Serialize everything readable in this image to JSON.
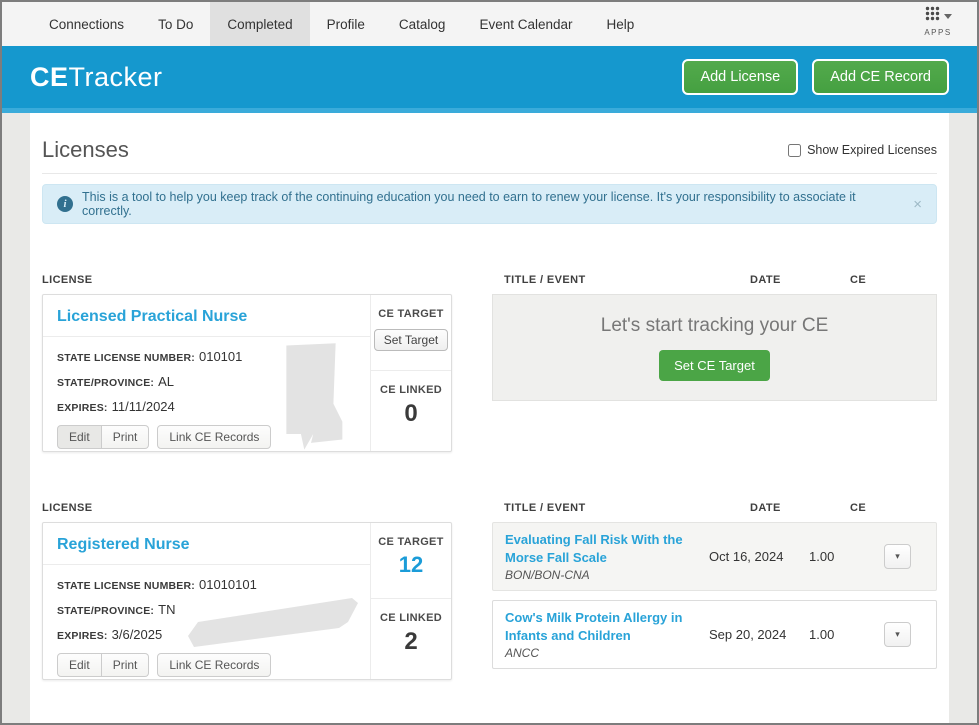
{
  "topnav": {
    "items": [
      {
        "label": "Connections",
        "active": false
      },
      {
        "label": "To Do",
        "active": false
      },
      {
        "label": "Completed",
        "active": true
      },
      {
        "label": "Profile",
        "active": false
      },
      {
        "label": "Catalog",
        "active": false
      },
      {
        "label": "Event Calendar",
        "active": false
      },
      {
        "label": "Help",
        "active": false
      }
    ],
    "apps_label": "APPS"
  },
  "header": {
    "logo_bold": "CE",
    "logo_light": "Tracker",
    "add_license_label": "Add License",
    "add_ce_record_label": "Add CE Record"
  },
  "page": {
    "title": "Licenses",
    "show_expired_label": "Show Expired Licenses",
    "info_message": "This is a tool to help you keep track of the continuing education you need to earn to renew your license. It's your responsibility to associate it correctly."
  },
  "labels": {
    "license_section": "LICENSE",
    "ce_target": "CE TARGET",
    "ce_linked": "CE LINKED",
    "title_event": "TITLE / EVENT",
    "date": "DATE",
    "ce": "CE",
    "state_license_number": "STATE LICENSE NUMBER:",
    "state_province": "STATE/PROVINCE:",
    "expires": "EXPIRES:",
    "edit": "Edit",
    "print": "Print",
    "link_ce_records": "Link CE Records",
    "set_target": "Set Target"
  },
  "licenses": [
    {
      "name": "Licensed Practical Nurse",
      "state_license_number": "010101",
      "state_province": "AL",
      "expires": "11/11/2024",
      "ce_linked": "0",
      "state_icon": "alabama"
    },
    {
      "name": "Registered Nurse",
      "state_license_number": "01010101",
      "state_province": "TN",
      "expires": "3/6/2025",
      "ce_target": "12",
      "ce_linked": "2",
      "state_icon": "tennessee"
    }
  ],
  "empty_state": {
    "message": "Let's start tracking your CE",
    "button_label": "Set CE Target"
  },
  "records": [
    {
      "title": "Evaluating Fall Risk With the Morse Fall Scale",
      "provider": "BON/BON-CNA",
      "date": "Oct 16, 2024",
      "ce": "1.00"
    },
    {
      "title": "Cow's Milk Protein Allergy in Infants and Children",
      "provider": "ANCC",
      "date": "Sep 20, 2024",
      "ce": "1.00"
    }
  ],
  "icons": {
    "info": "i",
    "close": "×",
    "caret_down": "▾"
  },
  "colors": {
    "brand_blue": "#1598ce",
    "brand_blue_light": "#3aabda",
    "button_green": "#4ba546",
    "link_blue": "#29a3d8",
    "alert_bg": "#d9edf7",
    "alert_text": "#31708f",
    "active_tab_bg": "#e0e0e0"
  }
}
